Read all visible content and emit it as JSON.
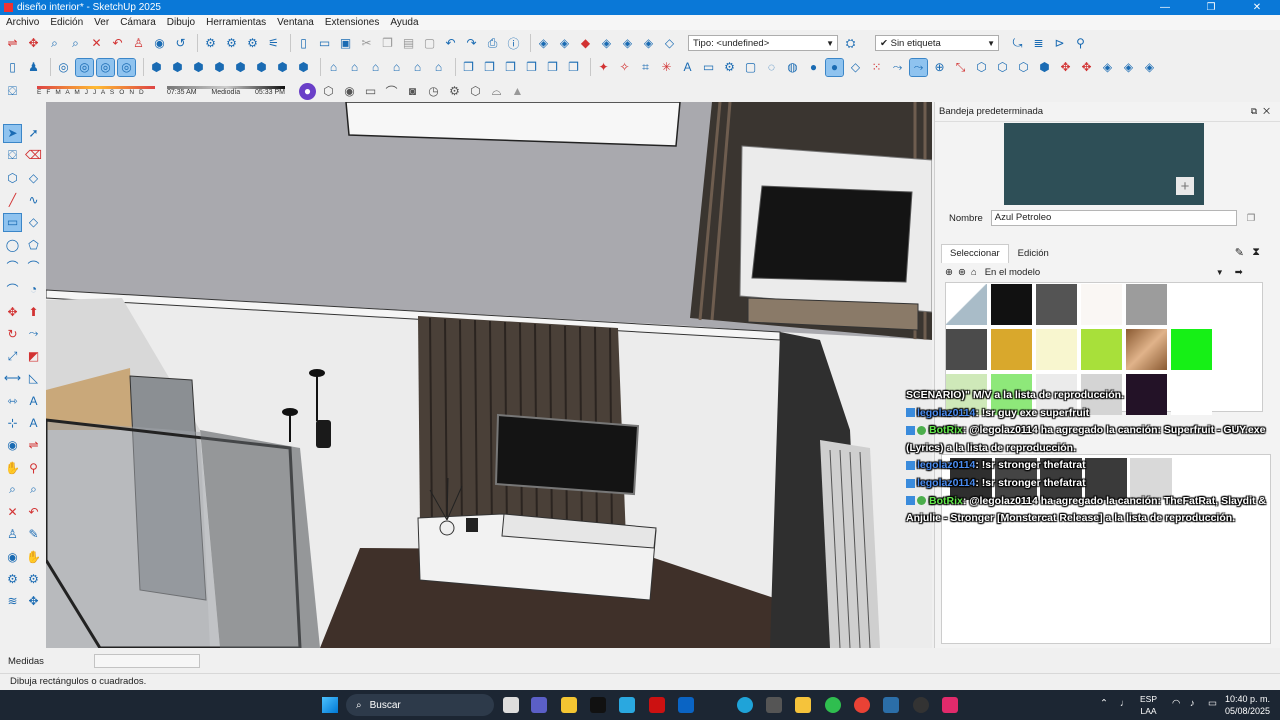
{
  "window": {
    "title": "diseño interior* - SketchUp 2025",
    "minimize": "—",
    "maximize": "❐",
    "close": "✕"
  },
  "menu": [
    "Archivo",
    "Edición",
    "Ver",
    "Cámara",
    "Dibujo",
    "Herramientas",
    "Ventana",
    "Extensiones",
    "Ayuda"
  ],
  "toolbar": {
    "tag_type": "Tipo: <undefined>",
    "tag_filter": "Sin etiqueta",
    "shadow_months": "E F M A M J J A S O N D",
    "time_start": "07:35 AM",
    "time_mid": "Mediodía",
    "time_end": "05:33 PM"
  },
  "tray": {
    "title": "Bandeja predeterminada",
    "name_label": "Nombre",
    "material_name": "Azul Petroleo",
    "tab_select": "Seleccionar",
    "tab_edit": "Edición",
    "library": "En el modelo",
    "swatch_color": "#2e4f57"
  },
  "chat": [
    {
      "user": "",
      "text": "SCENARIO)\" M/V a la lista de reproducción."
    },
    {
      "user": "legolaz0114",
      "text": ": !sr guy exe superfruit"
    },
    {
      "user": "BotRix",
      "text": ": @legolaz0114 ha agregado la canción: Superfruit - GUY.exe (Lyrics) a la lista de reproducción."
    },
    {
      "user": "legolaz0114",
      "text": ": !sr stronger thefatrat"
    },
    {
      "user": "legolaz0114",
      "text": ": !sr stronger thefatrat"
    },
    {
      "user": "BotRix",
      "text": ": @legolaz0114 ha agregado la canción: TheFatRat, Slaydit & Anjulie - Stronger [Monstercat Release] a la lista de reproducción."
    }
  ],
  "measures_label": "Medidas",
  "status_text": "Dibuja rectángulos o cuadrados.",
  "taskbar": {
    "search_placeholder": "Buscar",
    "lang_top": "ESP",
    "lang_bottom": "LAA",
    "time": "10:40 p. m.",
    "date": "05/08/2025"
  }
}
